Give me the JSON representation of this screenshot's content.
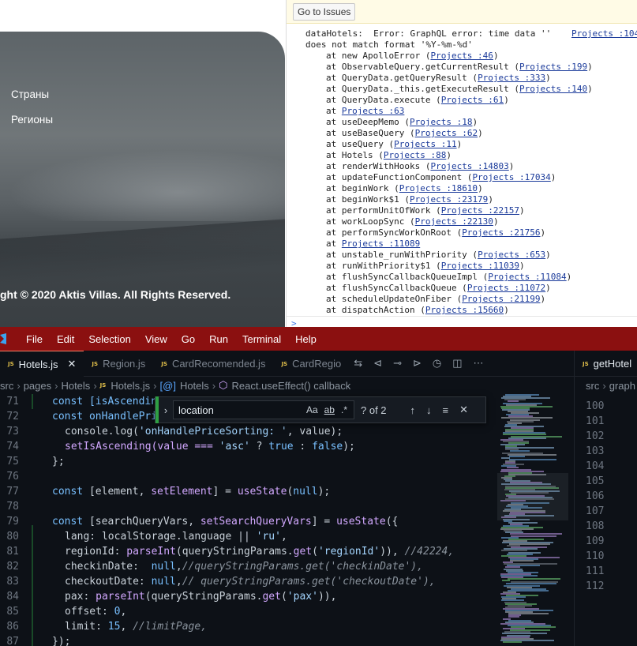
{
  "website": {
    "footer_links": [
      "Страны",
      "Регионы"
    ],
    "copyright": "ght © 2020 Aktis Villas. All Rights Reserved."
  },
  "console": {
    "go_to_issues": "Go to Issues",
    "error_line1": "dataHotels:  Error: GraphQL error: time data ''",
    "error_line2": "does not match format '%Y-%m-%d'",
    "error_source": "Projects :104",
    "stack": [
      {
        "fn": "at new ApolloError (",
        "src": "Projects :46",
        "end": ")"
      },
      {
        "fn": "at ObservableQuery.getCurrentResult (",
        "src": "Projects :199",
        "end": ")"
      },
      {
        "fn": "at QueryData.getQueryResult (",
        "src": "Projects :333",
        "end": ")"
      },
      {
        "fn": "at QueryData._this.getExecuteResult (",
        "src": "Projects :140",
        "end": ")"
      },
      {
        "fn": "at QueryData.execute (",
        "src": "Projects :61",
        "end": ")"
      },
      {
        "fn": "at ",
        "src": "Projects :63",
        "end": ""
      },
      {
        "fn": "at useDeepMemo (",
        "src": "Projects :18",
        "end": ")"
      },
      {
        "fn": "at useBaseQuery (",
        "src": "Projects :62",
        "end": ")"
      },
      {
        "fn": "at useQuery (",
        "src": "Projects :11",
        "end": ")"
      },
      {
        "fn": "at Hotels (",
        "src": "Projects :88",
        "end": ")"
      },
      {
        "fn": "at renderWithHooks (",
        "src": "Projects :14803",
        "end": ")"
      },
      {
        "fn": "at updateFunctionComponent (",
        "src": "Projects :17034",
        "end": ")"
      },
      {
        "fn": "at beginWork (",
        "src": "Projects :18610",
        "end": ")"
      },
      {
        "fn": "at beginWork$1 (",
        "src": "Projects :23179",
        "end": ")"
      },
      {
        "fn": "at performUnitOfWork (",
        "src": "Projects :22157",
        "end": ")"
      },
      {
        "fn": "at workLoopSync (",
        "src": "Projects :22130",
        "end": ")"
      },
      {
        "fn": "at performSyncWorkOnRoot (",
        "src": "Projects :21756",
        "end": ")"
      },
      {
        "fn": "at ",
        "src": "Projects :11089",
        "end": ""
      },
      {
        "fn": "at unstable_runWithPriority (",
        "src": "Projects :653",
        "end": ")"
      },
      {
        "fn": "at runWithPriority$1 (",
        "src": "Projects :11039",
        "end": ")"
      },
      {
        "fn": "at flushSyncCallbackQueueImpl (",
        "src": "Projects :11084",
        "end": ")"
      },
      {
        "fn": "at flushSyncCallbackQueue (",
        "src": "Projects :11072",
        "end": ")"
      },
      {
        "fn": "at scheduleUpdateOnFiber (",
        "src": "Projects :21199",
        "end": ")"
      },
      {
        "fn": "at dispatchAction (",
        "src": "Projects :15660",
        "end": ")"
      }
    ],
    "prompt": ">"
  },
  "vscode": {
    "menu": [
      "File",
      "Edit",
      "Selection",
      "View",
      "Go",
      "Run",
      "Terminal",
      "Help"
    ],
    "tabs": [
      {
        "label": "Hotels.js",
        "active": true
      },
      {
        "label": "Region.js",
        "active": false
      },
      {
        "label": "CardRecomended.js",
        "active": false
      },
      {
        "label": "CardRegio",
        "active": false
      }
    ],
    "right_tab": "getHotel",
    "breadcrumbs": [
      "src",
      "pages",
      "Hotels",
      "Hotels.js",
      "Hotels",
      "React.useEffect() callback"
    ],
    "right_breadcrumbs": [
      "src",
      "graph"
    ],
    "find": {
      "value": "location",
      "count": "? of 2",
      "case": "Aa",
      "word": "ab",
      "regex": ".*"
    },
    "line_numbers": [
      "71",
      "72",
      "73",
      "74",
      "75",
      "76",
      "77",
      "78",
      "79",
      "80",
      "81",
      "82",
      "83",
      "84",
      "85",
      "86",
      "87"
    ],
    "right_line_numbers": [
      "100",
      "101",
      "102",
      "103",
      "104",
      "105",
      "106",
      "107",
      "108",
      "109",
      "110",
      "111",
      "112"
    ],
    "code": {
      "l71": "const [isAscending",
      "l72a": "const onHandlePriceSorting = ({ value }) => {",
      "l73a": "console.log(",
      "l73b": "'onHandlePriceSorting: '",
      "l73c": ", value);",
      "l74a": "setIsAscending(value === ",
      "l74b": "'asc'",
      "l74c": " ? ",
      "l74d": "true",
      "l74e": " : ",
      "l74f": "false",
      "l74g": ");",
      "l75": "};",
      "l77a": "const",
      "l77b": " [element, ",
      "l77c": "setElement",
      "l77d": "] = ",
      "l77e": "useState",
      "l77f": "(",
      "l77g": "null",
      "l77h": ");",
      "l79a": "const",
      "l79b": " [searchQueryVars, ",
      "l79c": "setSearchQueryVars",
      "l79d": "] = ",
      "l79e": "useState",
      "l79f": "({",
      "l80a": "lang: localStorage.language || ",
      "l80b": "'ru'",
      "l80c": ",",
      "l81a": "regionId: ",
      "l81b": "parseInt",
      "l81c": "(queryStringParams.",
      "l81d": "get",
      "l81e": "(",
      "l81f": "'regionId'",
      "l81g": ")), ",
      "l81h": "//42224,",
      "l82a": "checkinDate:  ",
      "l82b": "null",
      "l82c": ",",
      "l82d": "//queryStringParams.get('checkinDate'),",
      "l83a": "checkoutDate: ",
      "l83b": "null",
      "l83c": ",",
      "l83d": "// queryStringParams.get('checkoutDate'),",
      "l84a": "pax: ",
      "l84b": "parseInt",
      "l84c": "(queryStringParams.",
      "l84d": "get",
      "l84e": "(",
      "l84f": "'pax'",
      "l84g": ")),",
      "l85a": "offset: ",
      "l85b": "0",
      "l85c": ",",
      "l86a": "limit: ",
      "l86b": "15",
      "l86c": ", ",
      "l86d": "//limitPage,",
      "l87": "});"
    }
  }
}
